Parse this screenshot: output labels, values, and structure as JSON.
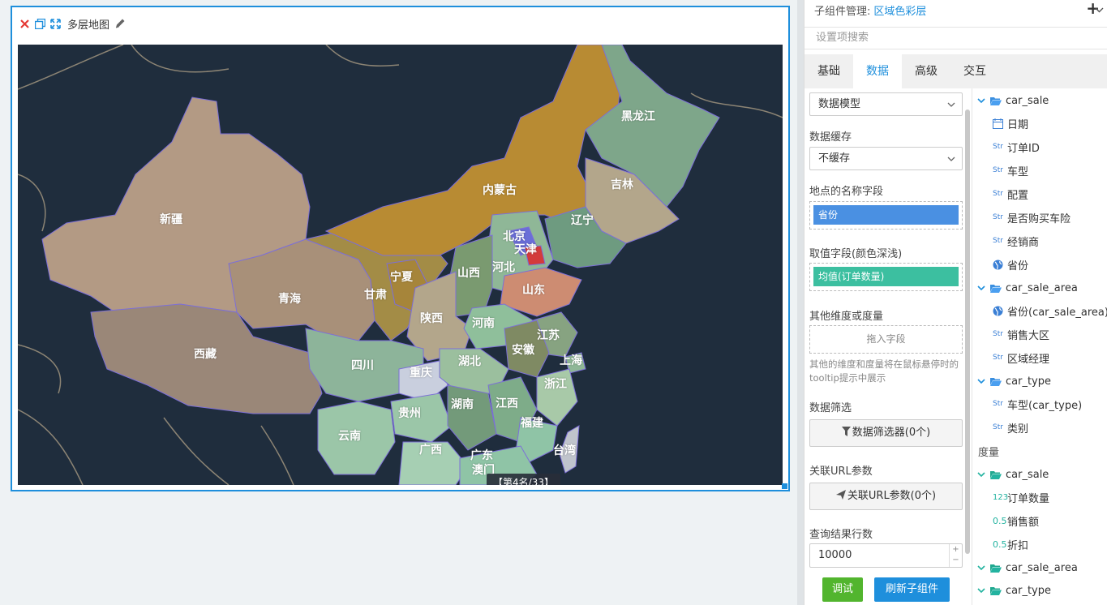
{
  "widget": {
    "title": "多层地图",
    "rank_badge": "【第4名/33】",
    "provinces": [
      {
        "name": "新疆"
      },
      {
        "name": "西藏"
      },
      {
        "name": "青海"
      },
      {
        "name": "甘肃"
      },
      {
        "name": "宁夏"
      },
      {
        "name": "内蒙古"
      },
      {
        "name": "黑龙江"
      },
      {
        "name": "吉林"
      },
      {
        "name": "辽宁"
      },
      {
        "name": "北京"
      },
      {
        "name": "天津"
      },
      {
        "name": "河北"
      },
      {
        "name": "山西"
      },
      {
        "name": "山东"
      },
      {
        "name": "陕西"
      },
      {
        "name": "河南"
      },
      {
        "name": "江苏"
      },
      {
        "name": "安徽"
      },
      {
        "name": "上海"
      },
      {
        "name": "四川"
      },
      {
        "name": "重庆"
      },
      {
        "name": "湖北"
      },
      {
        "name": "浙江"
      },
      {
        "name": "贵州"
      },
      {
        "name": "湖南"
      },
      {
        "name": "江西"
      },
      {
        "name": "云南"
      },
      {
        "name": "福建"
      },
      {
        "name": "广西"
      },
      {
        "name": "广东"
      },
      {
        "name": "台湾"
      },
      {
        "name": "澳门"
      }
    ]
  },
  "panel": {
    "sub_label": "子组件管理:",
    "sub_value": "区域色彩层",
    "search_placeholder": "设置项搜索",
    "tabs": [
      "基础",
      "数据",
      "高级",
      "交互"
    ],
    "data_model": "数据模型",
    "cache_label": "数据缓存",
    "cache_value": "不缓存",
    "place_field_label": "地点的名称字段",
    "place_field_chip": "省份",
    "value_field_label": "取值字段(颜色深浅)",
    "value_field_chip": "均值(订单数量)",
    "other_label": "其他维度或度量",
    "other_drop": "拖入字段",
    "other_hint": "其他的维度和度量将在鼠标悬停时的tooltip提示中展示",
    "filter_label": "数据筛选",
    "filter_button": "数据筛选器(0个)",
    "url_label": "关联URL参数",
    "url_button": "关联URL参数(0个)",
    "rows_label": "查询结果行数",
    "rows_value": "10000",
    "debug_button": "调试",
    "refresh_button": "刷新子组件"
  },
  "tree": {
    "dim_groups": [
      {
        "name": "car_sale",
        "fields": [
          {
            "type": "date",
            "name": "日期"
          },
          {
            "type": "Str",
            "name": "订单ID"
          },
          {
            "type": "Str",
            "name": "车型"
          },
          {
            "type": "Str",
            "name": "配置"
          },
          {
            "type": "Str",
            "name": "是否购买车险"
          },
          {
            "type": "Str",
            "name": "经销商"
          },
          {
            "type": "geo",
            "name": "省份"
          }
        ]
      },
      {
        "name": "car_sale_area",
        "fields": [
          {
            "type": "geo",
            "name": "省份(car_sale_area)"
          },
          {
            "type": "Str",
            "name": "销售大区"
          },
          {
            "type": "Str",
            "name": "区域经理"
          }
        ]
      },
      {
        "name": "car_type",
        "fields": [
          {
            "type": "Str",
            "name": "车型(car_type)"
          },
          {
            "type": "Str",
            "name": "类别"
          }
        ]
      }
    ],
    "measure_header": "度量",
    "measure_groups": [
      {
        "name": "car_sale",
        "fields": [
          {
            "type": "123",
            "name": "订单数量"
          },
          {
            "type": "0.5",
            "name": "销售额"
          },
          {
            "type": "0.5",
            "name": "折扣"
          }
        ]
      },
      {
        "name": "car_sale_area",
        "fields": []
      },
      {
        "name": "car_type",
        "fields": []
      }
    ]
  }
}
